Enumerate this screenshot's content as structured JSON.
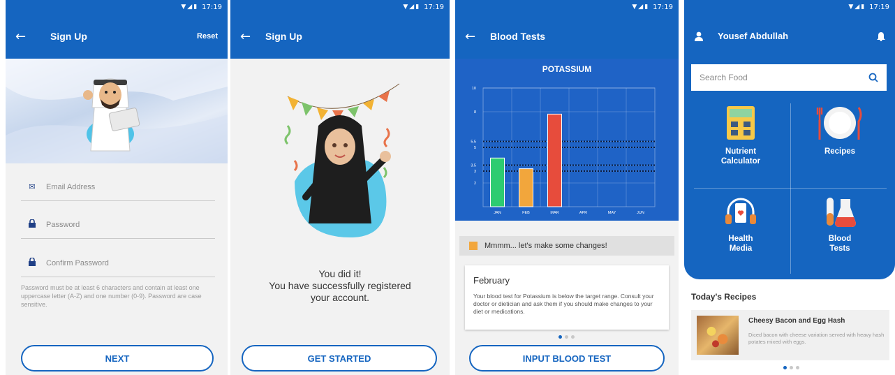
{
  "status_bar": {
    "time": "17:19"
  },
  "signup_form": {
    "title": "Sign Up",
    "reset_label": "Reset",
    "email_placeholder": "Email Address",
    "password_placeholder": "Password",
    "confirm_placeholder": "Confirm Password",
    "password_hint": "Password must be at least 6 characters and contain at least one uppercase letter (A-Z) and one number (0-9). Password are case sensitive.",
    "next_label": "NEXT"
  },
  "signup_success": {
    "title": "Sign Up",
    "message_line1": "You did it!",
    "message_line2": "You have successfully registered",
    "message_line3": "your account.",
    "get_started_label": "GET STARTED"
  },
  "blood_tests": {
    "title": "Blood Tests",
    "chart_title": "POTASSIUM",
    "message": "Mmmm... let's make some changes!",
    "card_month": "February",
    "card_body": "Your blood test for Potassium is below the target range. Consult your doctor or dietician and ask them if you should make changes to your diet or medications.",
    "input_button_label": "INPUT BLOOD TEST",
    "colors": {
      "green": "#2ecc71",
      "orange": "#f2a63c",
      "red": "#e74c3c",
      "panel": "#1f63c6"
    }
  },
  "chart_data": {
    "type": "bar",
    "title": "POTASSIUM",
    "categories": [
      "JAN",
      "FEB",
      "MAR",
      "APR",
      "MAY",
      "JUN"
    ],
    "values": [
      4.1,
      3.2,
      7.8,
      null,
      null,
      null
    ],
    "bar_colors": [
      "#2ecc71",
      "#f2a63c",
      "#e74c3c"
    ],
    "y_ticks": [
      "10",
      "8",
      "5.5",
      "5",
      "3.5",
      "3",
      "2"
    ],
    "target_lines": [
      5.5,
      5,
      3.5,
      3
    ],
    "ylim": [
      0,
      10
    ],
    "grid": true
  },
  "home": {
    "user_name": "Yousef Abdullah",
    "search_placeholder": "Search Food",
    "tiles": [
      {
        "line1": "Nutrient",
        "line2": "Calculator",
        "icon": "calculator-icon"
      },
      {
        "line1": "Recipes",
        "line2": "",
        "icon": "plate-icon"
      },
      {
        "line1": "Health",
        "line2": "Media",
        "icon": "headphones-phone-icon"
      },
      {
        "line1": "Blood",
        "line2": "Tests",
        "icon": "flask-icon"
      }
    ],
    "recipes_title": "Today's Recipes",
    "recipe_name": "Cheesy Bacon and Egg Hash",
    "recipe_desc": "Diced bacon with cheese variation served with heavy hash potates mixed with eggs."
  }
}
